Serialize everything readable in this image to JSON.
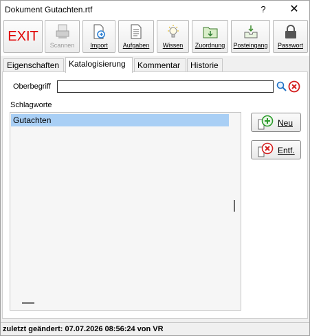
{
  "window": {
    "title": "Dokument Gutachten.rtf",
    "help": "?",
    "close": "✕"
  },
  "toolbar": {
    "exit": "EXIT",
    "scannen": "Scannen",
    "import": "Import",
    "aufgaben": "Aufgaben",
    "wissen": "Wissen",
    "zuordnung": "Zuordnung",
    "posteingang": "Posteingang",
    "passwort": "Passwort"
  },
  "tabs": [
    "Eigenschaften",
    "Katalogisierung",
    "Kommentar",
    "Historie"
  ],
  "form": {
    "oberbegriff_label": "Oberbegriff",
    "oberbegriff_value": "",
    "schlagworte_label": "Schlagworte",
    "schlagworte": [
      "Gutachten"
    ],
    "neu_label": "Neu",
    "entf_label": "Entf."
  },
  "status": {
    "text": "zuletzt geändert: 07.07.2026 08:56:24 von VR"
  },
  "colors": {
    "exit_red": "#e00000",
    "selection": "#a9cff5",
    "clear_red": "#d42020"
  }
}
